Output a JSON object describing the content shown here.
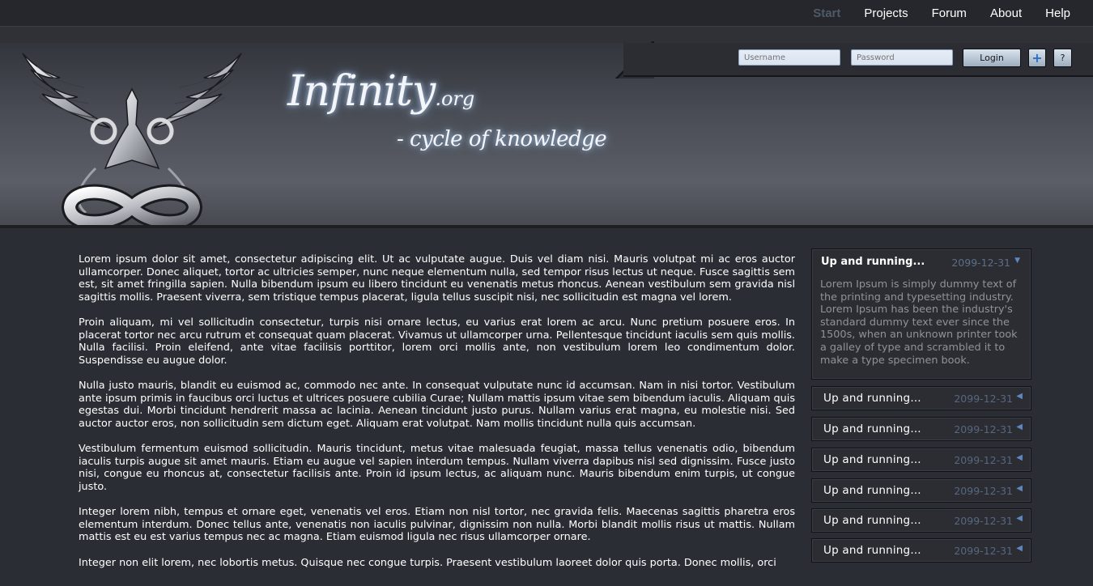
{
  "nav": {
    "items": [
      {
        "label": "Start",
        "active": true
      },
      {
        "label": "Projects",
        "active": false
      },
      {
        "label": "Forum",
        "active": false
      },
      {
        "label": "About",
        "active": false
      },
      {
        "label": "Help",
        "active": false
      }
    ]
  },
  "login": {
    "username_placeholder": "Username",
    "password_placeholder": "Password",
    "login_label": "Login",
    "add_icon": "+",
    "help_label": "?"
  },
  "brand": {
    "name": "Infinity",
    "suffix": ".org",
    "tagline": "- cycle of knowledge",
    "logo_icon": "phoenix-infinity-logo"
  },
  "content": {
    "paragraphs": [
      " Lorem ipsum dolor sit amet, consectetur adipiscing elit. Ut ac vulputate augue. Duis vel diam nisi. Mauris volutpat mi ac eros auctor ullamcorper. Donec aliquet, tortor ac ultricies semper, nunc neque elementum nulla, sed tempor risus lectus ut neque. Fusce sagittis sem est, sit amet fringilla sapien. Nulla bibendum ipsum eu libero tincidunt eu venenatis metus rhoncus. Aenean vestibulum sem gravida nisl sagittis mollis. Praesent viverra, sem tristique tempus placerat, ligula tellus suscipit nisi, nec sollicitudin est magna vel lorem.",
      "Proin aliquam, mi vel sollicitudin consectetur, turpis nisi ornare lectus, eu varius erat lorem ac arcu. Nunc pretium posuere eros. In placerat tortor nec arcu rutrum et consequat quam placerat. Vivamus ut ullamcorper urna. Pellentesque tincidunt iaculis sem quis mollis. Nulla facilisi. Proin eleifend, ante vitae facilisis porttitor, lorem orci mollis ante, non vestibulum lorem leo condimentum dolor. Suspendisse eu augue dolor.",
      "Nulla justo mauris, blandit eu euismod ac, commodo nec ante. In consequat vulputate nunc id accumsan. Nam in nisi tortor. Vestibulum ante ipsum primis in faucibus orci luctus et ultrices posuere cubilia Curae; Nullam mattis ipsum vitae sem bibendum iaculis. Aliquam quis egestas dui. Morbi tincidunt hendrerit massa ac lacinia. Aenean tincidunt justo purus. Nullam varius erat magna, eu molestie nisi. Sed auctor auctor eros, non sollicitudin sem dictum eget. Aliquam erat volutpat. Nam mollis tincidunt nulla quis accumsan.",
      "Vestibulum fermentum euismod sollicitudin. Mauris tincidunt, metus vitae malesuada feugiat, massa tellus venenatis odio, bibendum iaculis turpis augue sit amet mauris. Etiam eu augue vel sapien interdum tempus. Nullam viverra dapibus nisl sed dignissim. Fusce justo nisi, congue eu rhoncus at, consectetur facilisis ante. Proin id ipsum lectus, ac aliquam nunc. Mauris bibendum enim turpis, ut congue justo.",
      "Integer lorem nibh, tempus et ornare eget, venenatis vel eros. Etiam non nisl tortor, nec gravida felis. Maecenas sagittis pharetra eros elementum interdum. Donec tellus ante, venenatis non iaculis pulvinar, dignissim non nulla. Morbi blandit mollis risus ut mattis. Nullam mattis est eu est varius tempus nec ac magna. Etiam euismod ligula nec risus ullamcorper ornare.",
      "Integer non elit lorem, nec lobortis metus. Quisque nec congue turpis. Praesent vestibulum laoreet dolor quis porta. Donec mollis, orci"
    ]
  },
  "news": {
    "expanded": {
      "title": "Up and running...",
      "date": "2099-12-31",
      "body": "Lorem Ipsum is simply dummy text of the printing and typesetting industry. Lorem Ipsum has been the industry's standard dummy text ever since the 1500s, when an unknown printer took a galley of type and scrambled it to make a type specimen book."
    },
    "items": [
      {
        "title": "Up and running...",
        "date": "2099-12-31"
      },
      {
        "title": "Up and running...",
        "date": "2099-12-31"
      },
      {
        "title": "Up and running...",
        "date": "2099-12-31"
      },
      {
        "title": "Up and running...",
        "date": "2099-12-31"
      },
      {
        "title": "Up and running...",
        "date": "2099-12-31"
      },
      {
        "title": "Up and running...",
        "date": "2099-12-31"
      }
    ]
  },
  "colors": {
    "background": "#2a2d33",
    "nav_active": "#4f5a68",
    "date": "#5c6e87",
    "arrow": "#5e86c2"
  }
}
